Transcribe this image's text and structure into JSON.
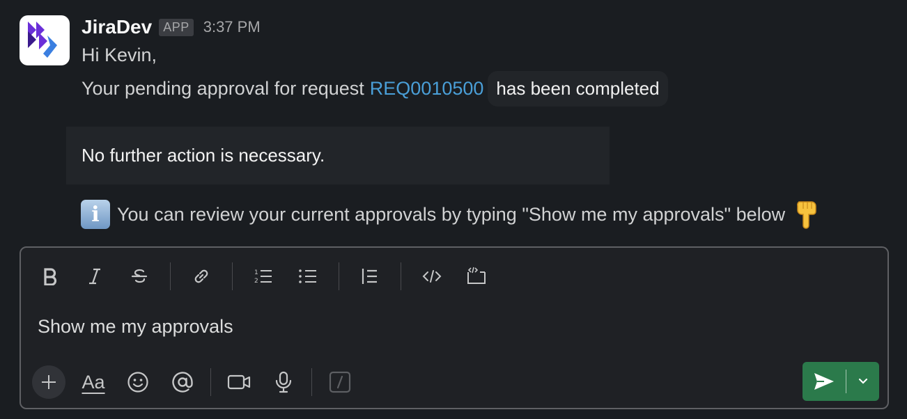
{
  "message": {
    "sender": "JiraDev",
    "badge": "APP",
    "time": "3:37 PM",
    "greeting": "Hi Kevin,",
    "line2_prefix": "Your pending approval for request",
    "request_id": "REQ0010500",
    "status_text": "has been completed",
    "notice": "No further action is necessary.",
    "info_text": "You can review your current approvals by typing \"Show me my approvals\" below",
    "info_icon_glyph": "i"
  },
  "composer": {
    "input_value": "Show me my approvals",
    "format_text_label": "Aa",
    "toolbar_icons": [
      "bold-icon",
      "italic-icon",
      "strikethrough-icon",
      "link-icon",
      "ordered-list-icon",
      "bulleted-list-icon",
      "blockquote-icon",
      "code-icon",
      "code-block-icon"
    ],
    "bottom_icons": [
      "plus-icon",
      "format-text-icon",
      "emoji-icon",
      "mention-icon",
      "video-icon",
      "microphone-icon",
      "slash-command-icon"
    ]
  },
  "colors": {
    "background": "#1a1d21",
    "link": "#4a9fd8",
    "send_button": "#2b7a4b"
  }
}
